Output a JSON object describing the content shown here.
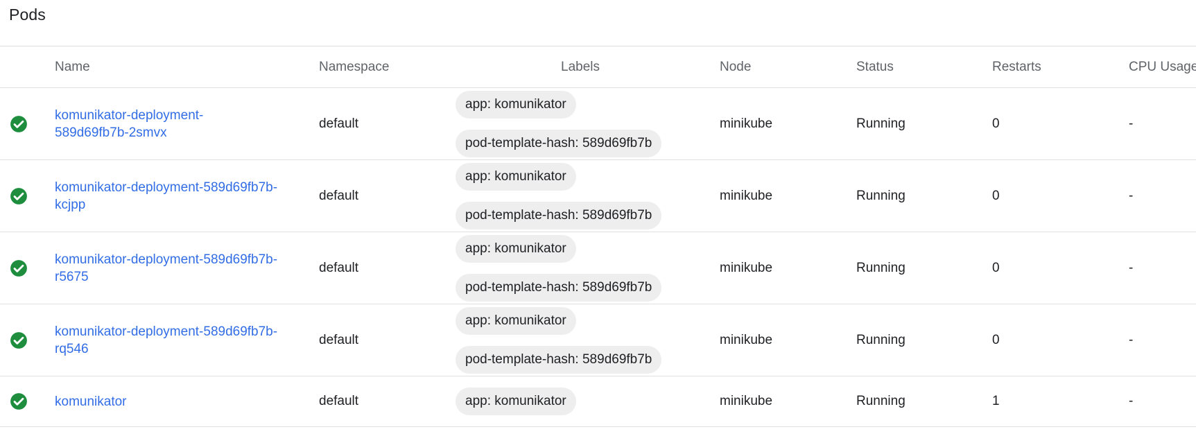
{
  "page": {
    "title": "Pods"
  },
  "table": {
    "headers": {
      "name": "Name",
      "namespace": "Namespace",
      "labels": "Labels",
      "node": "Node",
      "status": "Status",
      "restarts": "Restarts",
      "cpu": "CPU Usage"
    },
    "status_icon": "check-circle-icon",
    "status_color": "#1e8e3e",
    "link_color": "#326de6",
    "rows": [
      {
        "name_line1": "komunikator-deployment-",
        "name_line2": "589d69fb7b-2smvx",
        "namespace": "default",
        "label1": "app: komunikator",
        "label2": "pod-template-hash: 589d69fb7b",
        "node": "minikube",
        "status": "Running",
        "restarts": "0",
        "cpu": "-"
      },
      {
        "name_line1": "komunikator-deployment-589d69fb7b-",
        "name_line2": "kcjpp",
        "namespace": "default",
        "label1": "app: komunikator",
        "label2": "pod-template-hash: 589d69fb7b",
        "node": "minikube",
        "status": "Running",
        "restarts": "0",
        "cpu": "-"
      },
      {
        "name_line1": "komunikator-deployment-589d69fb7b-",
        "name_line2": "r5675",
        "namespace": "default",
        "label1": "app: komunikator",
        "label2": "pod-template-hash: 589d69fb7b",
        "node": "minikube",
        "status": "Running",
        "restarts": "0",
        "cpu": "-"
      },
      {
        "name_line1": "komunikator-deployment-589d69fb7b-",
        "name_line2": "rq546",
        "namespace": "default",
        "label1": "app: komunikator",
        "label2": "pod-template-hash: 589d69fb7b",
        "node": "minikube",
        "status": "Running",
        "restarts": "0",
        "cpu": "-"
      },
      {
        "name_line1": "komunikator",
        "namespace": "default",
        "label1": "app: komunikator",
        "node": "minikube",
        "status": "Running",
        "restarts": "1",
        "cpu": "-"
      }
    ]
  }
}
